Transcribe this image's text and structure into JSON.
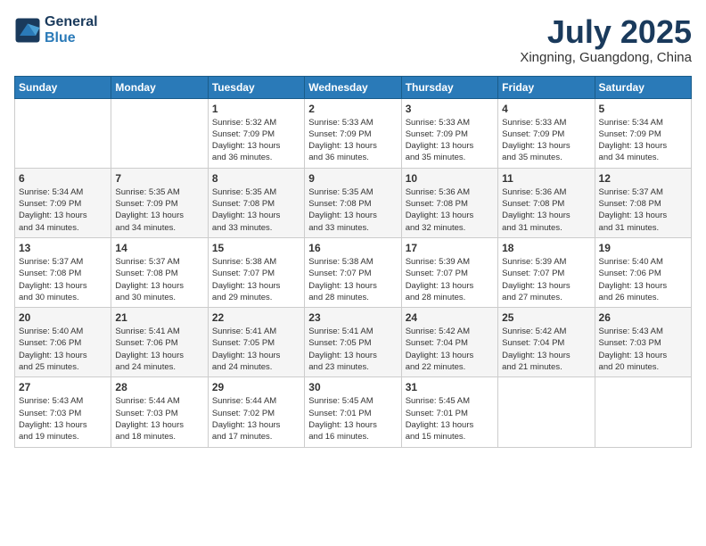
{
  "header": {
    "logo_line1": "General",
    "logo_line2": "Blue",
    "month": "July 2025",
    "location": "Xingning, Guangdong, China"
  },
  "weekdays": [
    "Sunday",
    "Monday",
    "Tuesday",
    "Wednesday",
    "Thursday",
    "Friday",
    "Saturday"
  ],
  "weeks": [
    [
      {
        "day": "",
        "info": ""
      },
      {
        "day": "",
        "info": ""
      },
      {
        "day": "1",
        "info": "Sunrise: 5:32 AM\nSunset: 7:09 PM\nDaylight: 13 hours\nand 36 minutes."
      },
      {
        "day": "2",
        "info": "Sunrise: 5:33 AM\nSunset: 7:09 PM\nDaylight: 13 hours\nand 36 minutes."
      },
      {
        "day": "3",
        "info": "Sunrise: 5:33 AM\nSunset: 7:09 PM\nDaylight: 13 hours\nand 35 minutes."
      },
      {
        "day": "4",
        "info": "Sunrise: 5:33 AM\nSunset: 7:09 PM\nDaylight: 13 hours\nand 35 minutes."
      },
      {
        "day": "5",
        "info": "Sunrise: 5:34 AM\nSunset: 7:09 PM\nDaylight: 13 hours\nand 34 minutes."
      }
    ],
    [
      {
        "day": "6",
        "info": "Sunrise: 5:34 AM\nSunset: 7:09 PM\nDaylight: 13 hours\nand 34 minutes."
      },
      {
        "day": "7",
        "info": "Sunrise: 5:35 AM\nSunset: 7:09 PM\nDaylight: 13 hours\nand 34 minutes."
      },
      {
        "day": "8",
        "info": "Sunrise: 5:35 AM\nSunset: 7:08 PM\nDaylight: 13 hours\nand 33 minutes."
      },
      {
        "day": "9",
        "info": "Sunrise: 5:35 AM\nSunset: 7:08 PM\nDaylight: 13 hours\nand 33 minutes."
      },
      {
        "day": "10",
        "info": "Sunrise: 5:36 AM\nSunset: 7:08 PM\nDaylight: 13 hours\nand 32 minutes."
      },
      {
        "day": "11",
        "info": "Sunrise: 5:36 AM\nSunset: 7:08 PM\nDaylight: 13 hours\nand 31 minutes."
      },
      {
        "day": "12",
        "info": "Sunrise: 5:37 AM\nSunset: 7:08 PM\nDaylight: 13 hours\nand 31 minutes."
      }
    ],
    [
      {
        "day": "13",
        "info": "Sunrise: 5:37 AM\nSunset: 7:08 PM\nDaylight: 13 hours\nand 30 minutes."
      },
      {
        "day": "14",
        "info": "Sunrise: 5:37 AM\nSunset: 7:08 PM\nDaylight: 13 hours\nand 30 minutes."
      },
      {
        "day": "15",
        "info": "Sunrise: 5:38 AM\nSunset: 7:07 PM\nDaylight: 13 hours\nand 29 minutes."
      },
      {
        "day": "16",
        "info": "Sunrise: 5:38 AM\nSunset: 7:07 PM\nDaylight: 13 hours\nand 28 minutes."
      },
      {
        "day": "17",
        "info": "Sunrise: 5:39 AM\nSunset: 7:07 PM\nDaylight: 13 hours\nand 28 minutes."
      },
      {
        "day": "18",
        "info": "Sunrise: 5:39 AM\nSunset: 7:07 PM\nDaylight: 13 hours\nand 27 minutes."
      },
      {
        "day": "19",
        "info": "Sunrise: 5:40 AM\nSunset: 7:06 PM\nDaylight: 13 hours\nand 26 minutes."
      }
    ],
    [
      {
        "day": "20",
        "info": "Sunrise: 5:40 AM\nSunset: 7:06 PM\nDaylight: 13 hours\nand 25 minutes."
      },
      {
        "day": "21",
        "info": "Sunrise: 5:41 AM\nSunset: 7:06 PM\nDaylight: 13 hours\nand 24 minutes."
      },
      {
        "day": "22",
        "info": "Sunrise: 5:41 AM\nSunset: 7:05 PM\nDaylight: 13 hours\nand 24 minutes."
      },
      {
        "day": "23",
        "info": "Sunrise: 5:41 AM\nSunset: 7:05 PM\nDaylight: 13 hours\nand 23 minutes."
      },
      {
        "day": "24",
        "info": "Sunrise: 5:42 AM\nSunset: 7:04 PM\nDaylight: 13 hours\nand 22 minutes."
      },
      {
        "day": "25",
        "info": "Sunrise: 5:42 AM\nSunset: 7:04 PM\nDaylight: 13 hours\nand 21 minutes."
      },
      {
        "day": "26",
        "info": "Sunrise: 5:43 AM\nSunset: 7:03 PM\nDaylight: 13 hours\nand 20 minutes."
      }
    ],
    [
      {
        "day": "27",
        "info": "Sunrise: 5:43 AM\nSunset: 7:03 PM\nDaylight: 13 hours\nand 19 minutes."
      },
      {
        "day": "28",
        "info": "Sunrise: 5:44 AM\nSunset: 7:03 PM\nDaylight: 13 hours\nand 18 minutes."
      },
      {
        "day": "29",
        "info": "Sunrise: 5:44 AM\nSunset: 7:02 PM\nDaylight: 13 hours\nand 17 minutes."
      },
      {
        "day": "30",
        "info": "Sunrise: 5:45 AM\nSunset: 7:01 PM\nDaylight: 13 hours\nand 16 minutes."
      },
      {
        "day": "31",
        "info": "Sunrise: 5:45 AM\nSunset: 7:01 PM\nDaylight: 13 hours\nand 15 minutes."
      },
      {
        "day": "",
        "info": ""
      },
      {
        "day": "",
        "info": ""
      }
    ]
  ]
}
